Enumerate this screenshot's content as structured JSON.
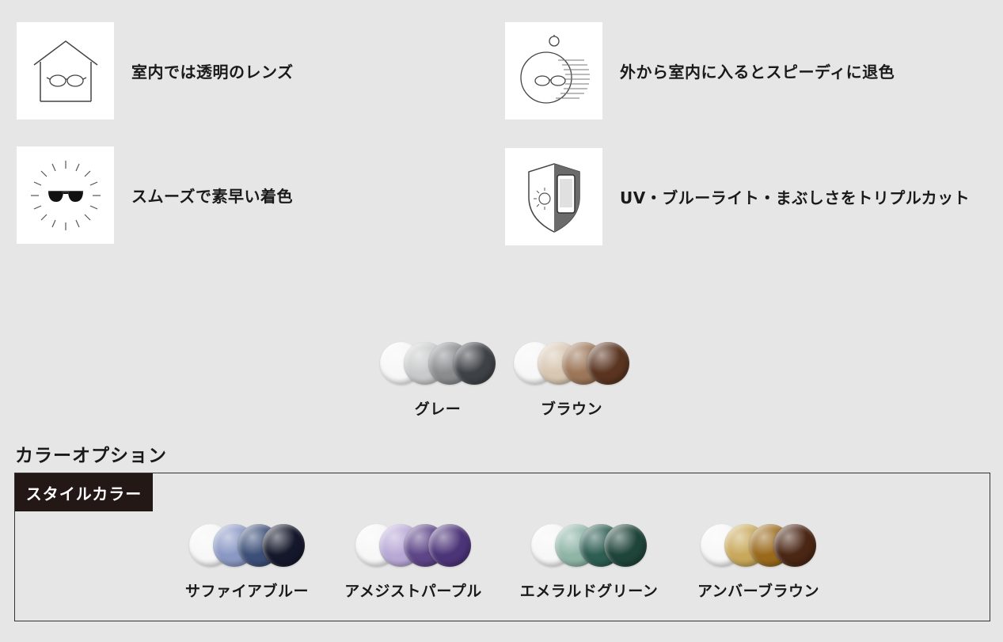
{
  "features": [
    {
      "label": "室内では透明のレンズ",
      "icon": "house-eyeglasses-icon"
    },
    {
      "label": "外から室内に入るとスピーディに退色",
      "icon": "stopwatch-eyeglasses-icon"
    },
    {
      "label": "スムーズで素早い着色",
      "icon": "sun-sunglasses-icon"
    },
    {
      "label": "UV・ブルーライト・まぶしさをトリプルカット",
      "icon": "shield-phone-icon"
    }
  ],
  "standard_colors": [
    {
      "name": "グレー",
      "swatches": [
        "#f7f7f7",
        "#c9cacb",
        "#8a8c8e",
        "#3e4247"
      ]
    },
    {
      "name": "ブラウン",
      "swatches": [
        "#f7f7f7",
        "#d8c7b2",
        "#9c7658",
        "#5a3420"
      ]
    }
  ],
  "color_option": {
    "title": "カラーオプション",
    "tag": "スタイルカラー",
    "colors": [
      {
        "name": "サファイアブルー",
        "swatches": [
          "#f7f7f7",
          "#8a98c4",
          "#3c4f78",
          "#15182b"
        ]
      },
      {
        "name": "アメジストパープル",
        "swatches": [
          "#f7f7f7",
          "#b8a8d6",
          "#5d4587",
          "#4c3478"
        ]
      },
      {
        "name": "エメラルドグリーン",
        "swatches": [
          "#f7f7f7",
          "#8fb5a7",
          "#2e5d52",
          "#1f4439"
        ]
      },
      {
        "name": "アンバーブラウン",
        "swatches": [
          "#f7f7f7",
          "#c8a85a",
          "#9a6a1c",
          "#4a2614"
        ]
      }
    ]
  }
}
